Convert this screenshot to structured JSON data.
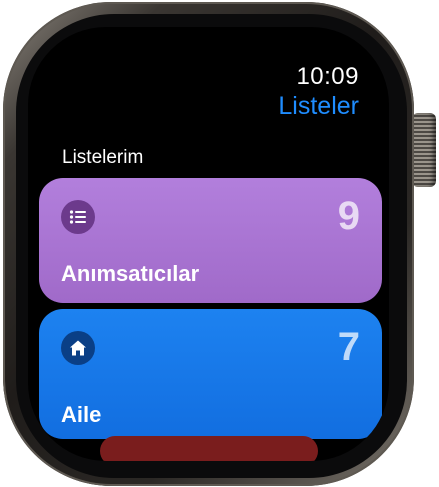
{
  "status": {
    "time": "10:09"
  },
  "header": {
    "title": "Listeler"
  },
  "section": {
    "label": "Listelerim"
  },
  "lists": [
    {
      "name": "Anımsatıcılar",
      "count": "9",
      "icon": "list-bullet-icon",
      "color": "#a675d2"
    },
    {
      "name": "Aile",
      "count": "7",
      "icon": "house-icon",
      "color": "#1778e8"
    }
  ],
  "colors": {
    "accent": "#1f8dff",
    "next_list": "#7a1d1d"
  }
}
